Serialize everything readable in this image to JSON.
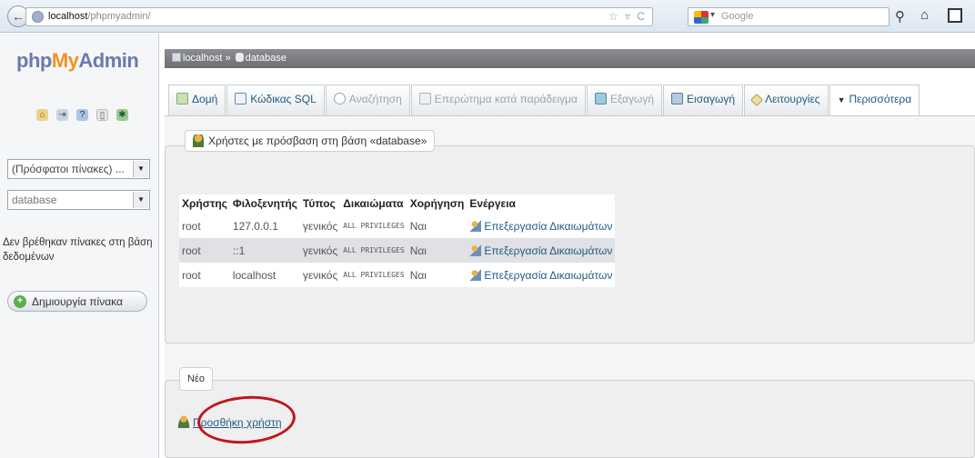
{
  "browser": {
    "url_host": "localhost",
    "url_path": "/phpmyadmin/",
    "url_controls": "☆ ▿ C",
    "search_placeholder": "Google"
  },
  "sidebar": {
    "logo_php": "php",
    "logo_my": "My",
    "logo_admin": "Admin",
    "recent_select": "(Πρόσφατοι πίνακες) ...",
    "db_select": "database",
    "no_tables_text": "Δεν βρέθηκαν πίνακες στη βάση δεδομένων",
    "create_table_label": "Δημιουργία πίνακα"
  },
  "breadcrumb": {
    "server": "localhost",
    "separator": "»",
    "database": "database"
  },
  "tabs": [
    {
      "label": "Δομή",
      "icon": "structure-icon"
    },
    {
      "label": "Κώδικας SQL",
      "icon": "sql-icon"
    },
    {
      "label": "Αναζήτηση",
      "icon": "search-icon"
    },
    {
      "label": "Επερώτημα κατά παράδειγμα",
      "icon": "query-icon"
    },
    {
      "label": "Εξαγωγή",
      "icon": "export-icon"
    },
    {
      "label": "Εισαγωγή",
      "icon": "import-icon"
    },
    {
      "label": "Λειτουργίες",
      "icon": "operations-icon"
    },
    {
      "label": "Περισσότερα",
      "icon": "triangle-down-icon"
    }
  ],
  "users_section": {
    "legend": "Χρήστες με πρόσβαση στη βάση «database»",
    "columns": [
      "Χρήστης",
      "Φιλοξενητής",
      "Τύπος",
      "Δικαιώματα",
      "Χορήγηση",
      "Ενέργεια"
    ],
    "rows": [
      {
        "user": "root",
        "host": "127.0.0.1",
        "type": "γενικός",
        "privileges": "ALL PRIVILEGES",
        "grant": "Ναι",
        "action": "Επεξεργασία Δικαιωμάτων"
      },
      {
        "user": "root",
        "host": "::1",
        "type": "γενικός",
        "privileges": "ALL PRIVILEGES",
        "grant": "Ναι",
        "action": "Επεξεργασία Δικαιωμάτων"
      },
      {
        "user": "root",
        "host": "localhost",
        "type": "γενικός",
        "privileges": "ALL PRIVILEGES",
        "grant": "Ναι",
        "action": "Επεξεργασία Δικαιωμάτων"
      }
    ]
  },
  "new_section": {
    "legend": "Νέο",
    "add_user_label": "Προσθήκη χρήστη"
  },
  "colors": {
    "accent_link": "#235a81",
    "logo_orange": "#f29220",
    "highlight_ring": "#c2141a"
  }
}
